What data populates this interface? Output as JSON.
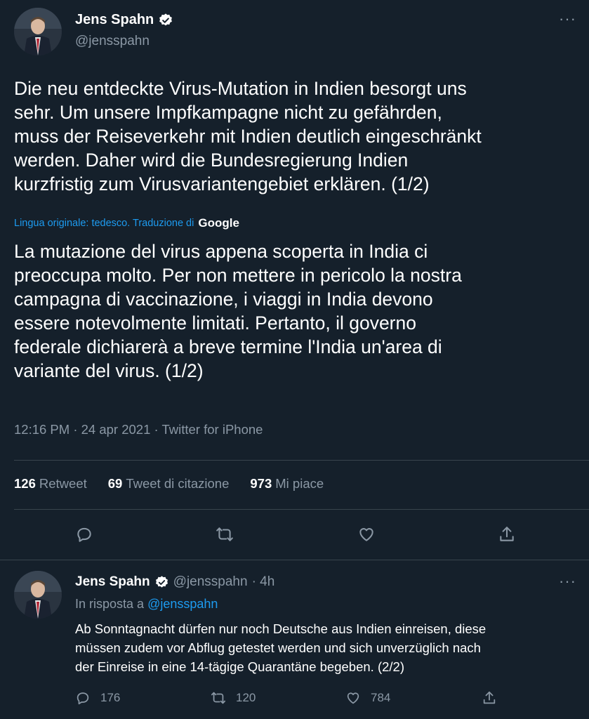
{
  "main_tweet": {
    "author_name": "Jens Spahn",
    "author_handle": "@jensspahn",
    "more": "···",
    "original_text": "Die neu entdeckte Virus-Mutation in Indien besorgt uns\nsehr. Um unsere Impfkampagne nicht zu gefährden,\nmuss der Reiseverkehr mit Indien deutlich eingeschränkt\nwerden. Daher wird die Bundesregierung Indien\nkurzfristig zum Virusvariantengebiet erklären. (1/2)",
    "translation_note": "Lingua originale: tedesco. Traduzione di",
    "translation_provider": "Google",
    "translated_text": "La mutazione del virus appena scoperta in India ci\npreoccupa molto. Per non mettere in pericolo la nostra\ncampagna di vaccinazione, i viaggi in India devono\nessere notevolmente limitati. Pertanto, il governo\nfederale dichiarerà a breve termine l'India un'area di\nvariante del virus. (1/2)",
    "meta": "12:16 PM · 24 apr 2021 · Twitter for iPhone",
    "stats": {
      "retweets_count": "126",
      "retweets_label": "Retweet",
      "quotes_count": "69",
      "quotes_label": "Tweet di citazione",
      "likes_count": "973",
      "likes_label": "Mi piace"
    },
    "action_icons": [
      "reply-icon",
      "retweet-icon",
      "like-icon",
      "share-icon"
    ]
  },
  "reply_tweet": {
    "author_name": "Jens Spahn",
    "author_handle": "@jensspahn",
    "time": "· 4h",
    "more": "···",
    "reply_prefix": "In risposta a",
    "reply_handle": "@jensspahn",
    "text": "Ab Sonntagnacht dürfen nur noch Deutsche aus Indien einreisen, diese\nmüssen zudem vor Abflug getestet werden und sich unverzüglich nach\nder Einreise in eine 14-tägige Quarantäne begeben. (2/2)",
    "reply_count": "176",
    "retweet_count": "120",
    "like_count": "784"
  },
  "colors": {
    "background": "#15202b",
    "accent": "#1d9bf0",
    "muted": "#8b98a5",
    "divider": "#38444d"
  }
}
